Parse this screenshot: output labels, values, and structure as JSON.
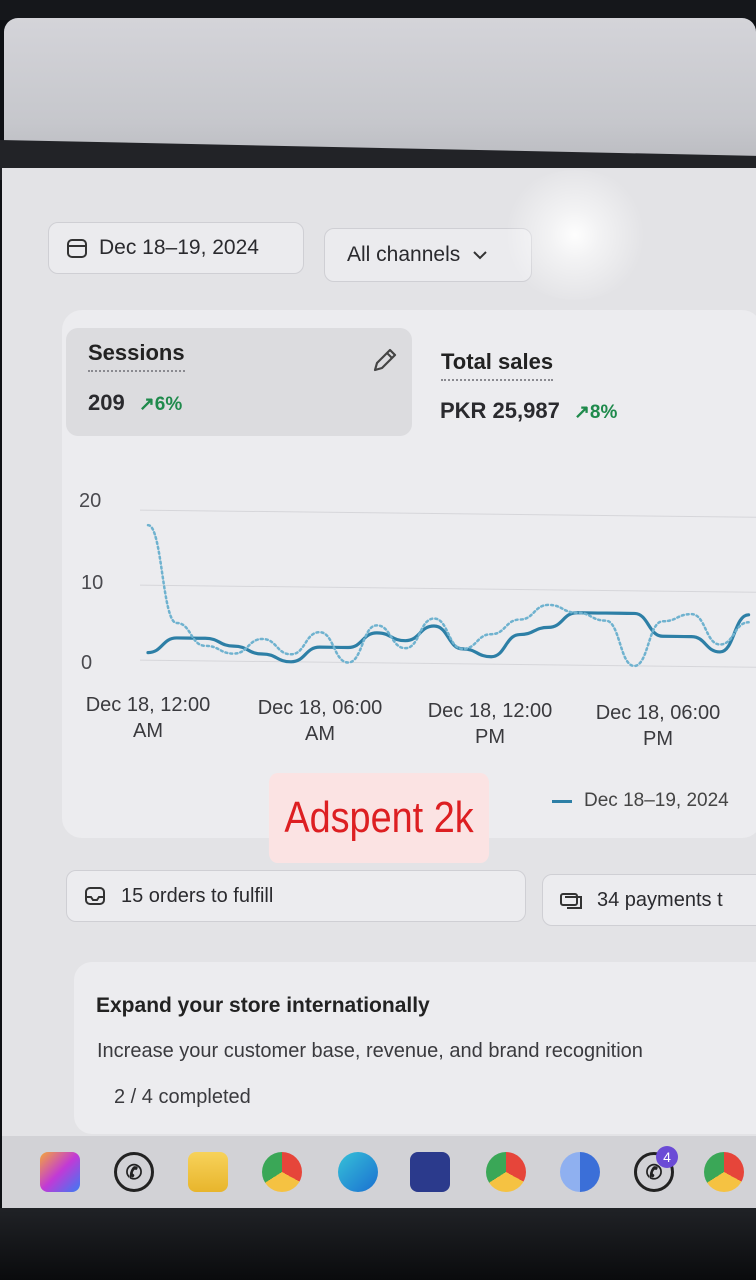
{
  "filters": {
    "date_range": "Dec 18–19, 2024",
    "channel": "All channels"
  },
  "metrics": {
    "sessions": {
      "label": "Sessions",
      "value": "209",
      "change": "6%"
    },
    "total_sales": {
      "label": "Total sales",
      "value": "PKR 25,987",
      "change": "8%"
    }
  },
  "overlay_text": "Adspent 2k",
  "legend": {
    "current": "Dec 18–19, 2024"
  },
  "tasks": {
    "orders": "15 orders to fulfill",
    "payments": "34 payments t"
  },
  "promo": {
    "title": "Expand your store internationally",
    "description": "Increase your customer base, revenue, and brand recognition",
    "progress": "2 / 4 completed"
  },
  "taskbar_icons": [
    "copilot-icon",
    "whatsapp-icon",
    "file-explorer-icon",
    "chrome-icon",
    "edge-icon",
    "microsoft-store-icon",
    "chrome-profile-icon",
    "chrome-app-icon",
    "whatsapp-icon",
    "chrome-icon"
  ],
  "taskbar_badge": "4",
  "colors": {
    "series_current": "#2d7fa6",
    "series_previous": "#6fb2cf",
    "trend_up": "#1f8a4c",
    "overlay_text": "#dd1f22",
    "overlay_bg": "#fbe3e3"
  },
  "chart_data": {
    "type": "line",
    "ylim": [
      0,
      20
    ],
    "y_ticks": [
      "20",
      "10",
      "0"
    ],
    "x_ticks": [
      [
        "Dec 18, 12:00",
        "AM"
      ],
      [
        "Dec 18, 06:00",
        "AM"
      ],
      [
        "Dec 18, 12:00",
        "PM"
      ],
      [
        "Dec 18, 06:00",
        "PM"
      ]
    ],
    "x_hours": [
      0,
      1,
      2,
      3,
      4,
      5,
      6,
      7,
      8,
      9,
      10,
      11,
      12,
      13,
      14,
      15,
      16,
      17,
      18,
      19,
      20,
      21
    ],
    "series": [
      {
        "name": "Dec 18–19, 2024",
        "style": "solid",
        "values": [
          1,
          3,
          3,
          2,
          1,
          0,
          2,
          2,
          4,
          3,
          5,
          2,
          1,
          4,
          5,
          7,
          7,
          7,
          4,
          4,
          2,
          7
        ]
      },
      {
        "style": "dotted",
        "values": [
          18,
          5,
          2,
          1,
          3,
          1,
          4,
          0,
          5,
          2,
          6,
          2,
          4,
          6,
          8,
          7,
          6,
          0,
          6,
          7,
          3,
          6
        ]
      }
    ]
  }
}
